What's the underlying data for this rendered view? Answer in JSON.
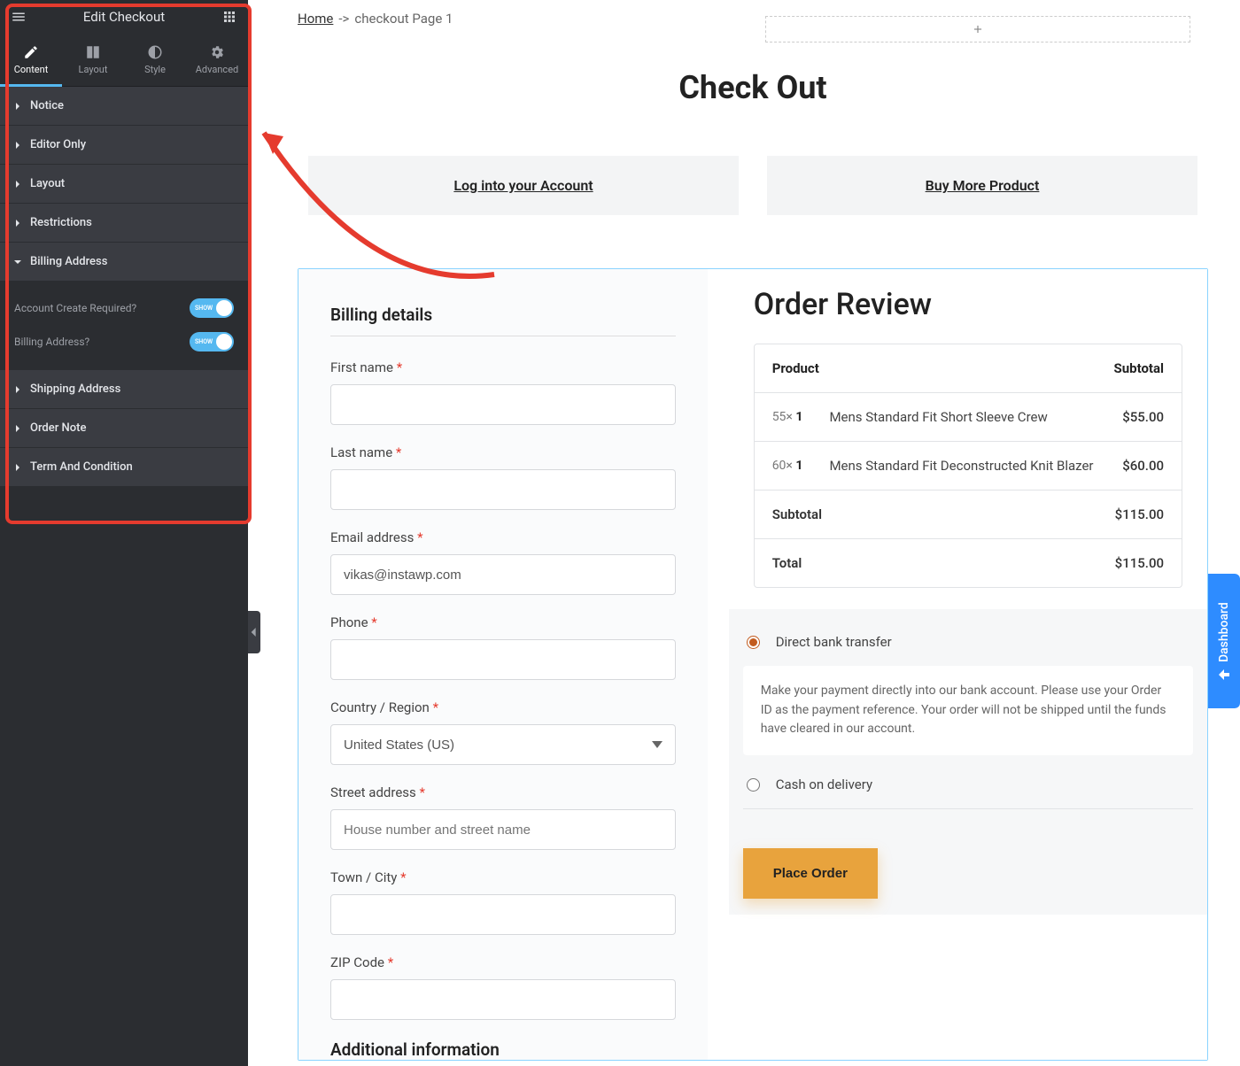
{
  "panel": {
    "title": "Edit Checkout",
    "tabs": [
      "Content",
      "Layout",
      "Style",
      "Advanced"
    ],
    "accordions": {
      "notice": "Notice",
      "editor_only": "Editor Only",
      "layout": "Layout",
      "restrictions": "Restrictions",
      "billing_address": "Billing Address",
      "shipping_address": "Shipping Address",
      "order_note": "Order Note",
      "term_condition": "Term And Condition"
    },
    "toggles": {
      "account_create": "Account Create Required?",
      "billing_address_show": "Billing Address?"
    }
  },
  "breadcrumb": {
    "home": "Home",
    "sep": "->",
    "current": "checkout Page 1"
  },
  "page_title": "Check Out",
  "link_cards": {
    "login": "Log into your Account",
    "buy_more": "Buy More Product"
  },
  "billing": {
    "title": "Billing details",
    "first_name": "First name",
    "last_name": "Last name",
    "email": "Email address",
    "email_value": "vikas@instawp.com",
    "phone": "Phone",
    "country": "Country / Region",
    "country_value": "United States (US)",
    "street": "Street address",
    "street_placeholder": "House number and street name",
    "town": "Town / City",
    "zip": "ZIP Code",
    "additional": "Additional information"
  },
  "review": {
    "title": "Order Review",
    "head_product": "Product",
    "head_subtotal": "Subtotal",
    "items": [
      {
        "qty_prefix": "55×",
        "qty_num": "1",
        "name": "Mens Standard Fit Short Sleeve Crew",
        "price": "$55.00"
      },
      {
        "qty_prefix": "60×",
        "qty_num": "1",
        "name": "Mens Standard Fit Deconstructed Knit Blazer",
        "price": "$60.00"
      }
    ],
    "subtotal_label": "Subtotal",
    "subtotal_value": "$115.00",
    "total_label": "Total",
    "total_value": "$115.00"
  },
  "payment": {
    "bank": "Direct bank transfer",
    "bank_desc": "Make your payment directly into our bank account. Please use your Order ID as the payment reference. Your order will not be shipped until the funds have cleared in our account.",
    "cod": "Cash on delivery",
    "place_order": "Place Order"
  },
  "dashboard_tab": "Dashboard"
}
